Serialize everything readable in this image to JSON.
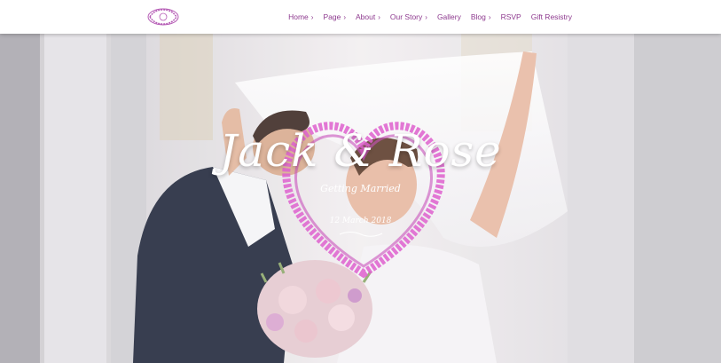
{
  "brand": {
    "logo_icon": "monogram-wreath-icon",
    "logo_text": "J&R",
    "accent_color": "#8e3a8f"
  },
  "nav": {
    "items": [
      {
        "label": "Home",
        "has_dropdown": true
      },
      {
        "label": "Page",
        "has_dropdown": true
      },
      {
        "label": "About",
        "has_dropdown": true
      },
      {
        "label": "Our Story",
        "has_dropdown": true
      },
      {
        "label": "Gallery",
        "has_dropdown": false
      },
      {
        "label": "Blog",
        "has_dropdown": true
      },
      {
        "label": "RSVP",
        "has_dropdown": false
      },
      {
        "label": "Gift Resistry",
        "has_dropdown": false
      }
    ],
    "chevron": "›"
  },
  "hero": {
    "title": "Jack & Rose",
    "subtitle": "Getting Married",
    "date": "12 March 2018",
    "heart_color": "#d94bc8",
    "photo_description_icon": "couple-kiss-photo"
  }
}
